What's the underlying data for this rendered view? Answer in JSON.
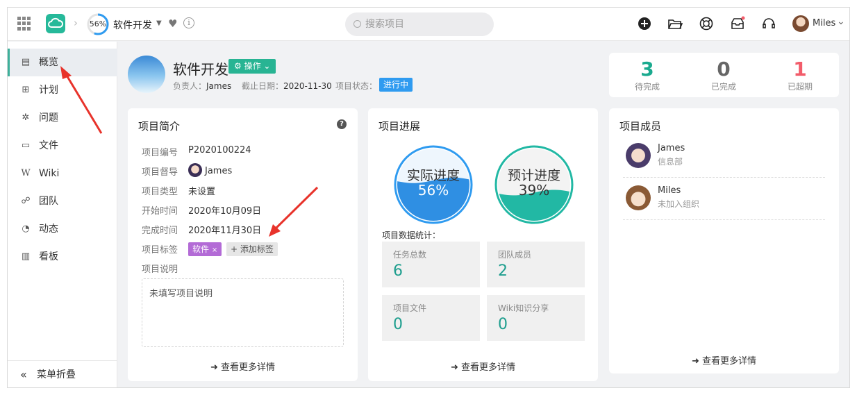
{
  "topbar": {
    "progress_percent": 56,
    "progress_label": "56%",
    "project_name": "软件开发",
    "search_placeholder": "搜索项目",
    "user_name": "Miles",
    "icons": [
      "apps-grid-icon",
      "cloud-logo-icon",
      "heart-icon",
      "info-icon",
      "add-icon",
      "folder-icon",
      "lifebuoy-icon",
      "inbox-icon",
      "headset-icon"
    ]
  },
  "sidebar": {
    "items": [
      {
        "label": "概览",
        "icon": "overview-icon"
      },
      {
        "label": "计划",
        "icon": "plan-icon"
      },
      {
        "label": "问题",
        "icon": "bug-icon"
      },
      {
        "label": "文件",
        "icon": "folder-icon"
      },
      {
        "label": "Wiki",
        "icon": "wiki-icon"
      },
      {
        "label": "团队",
        "icon": "team-icon"
      },
      {
        "label": "动态",
        "icon": "activity-icon"
      },
      {
        "label": "看板",
        "icon": "kanban-icon"
      }
    ],
    "collapse_label": "菜单折叠"
  },
  "header": {
    "title": "软件开发",
    "action_label": "操作",
    "owner_label": "负责人：",
    "owner": "James",
    "deadline_label": "截止日期：",
    "deadline": "2020-11-30",
    "status_label": "项目状态：",
    "status": "进行中"
  },
  "stats": [
    {
      "value": "3",
      "label": "待完成",
      "color": "#1aaa8f"
    },
    {
      "value": "0",
      "label": "已完成",
      "color": "#666666"
    },
    {
      "value": "1",
      "label": "已超期",
      "color": "#f25c6a"
    }
  ],
  "intro": {
    "title": "项目简介",
    "rows": [
      {
        "label": "项目编号",
        "value": "P2020100224"
      },
      {
        "label": "项目督导",
        "value": "James"
      },
      {
        "label": "项目类型",
        "value": "未设置"
      },
      {
        "label": "开始时间",
        "value": "2020年10月09日"
      },
      {
        "label": "完成时间",
        "value": "2020年11月30日"
      }
    ],
    "tags_label": "项目标签",
    "tag": "软件",
    "add_tag": "+ 添加标签",
    "desc_label": "项目说明",
    "desc_placeholder": "未填写项目说明",
    "more": "查看更多详情"
  },
  "progress": {
    "title": "项目进展",
    "actual_label": "实际进度",
    "actual_value": "56%",
    "actual_percent": 56,
    "plan_label": "预计进度",
    "plan_value": "39%",
    "plan_percent": 39,
    "stats_title": "项目数据统计：",
    "boxes": [
      {
        "label": "任务总数",
        "value": "6"
      },
      {
        "label": "团队成员",
        "value": "2"
      },
      {
        "label": "项目文件",
        "value": "0"
      },
      {
        "label": "Wiki知识分享",
        "value": "0"
      }
    ],
    "more": "查看更多详情"
  },
  "members": {
    "title": "项目成员",
    "list": [
      {
        "name": "James",
        "dept": "信息部"
      },
      {
        "name": "Miles",
        "dept": "未加入组织"
      }
    ],
    "more": "查看更多详情"
  },
  "colors": {
    "accent": "#26b99a",
    "blue": "#2f9bf0",
    "purple": "#b36bd6",
    "red_arrow": "#e8332b"
  }
}
